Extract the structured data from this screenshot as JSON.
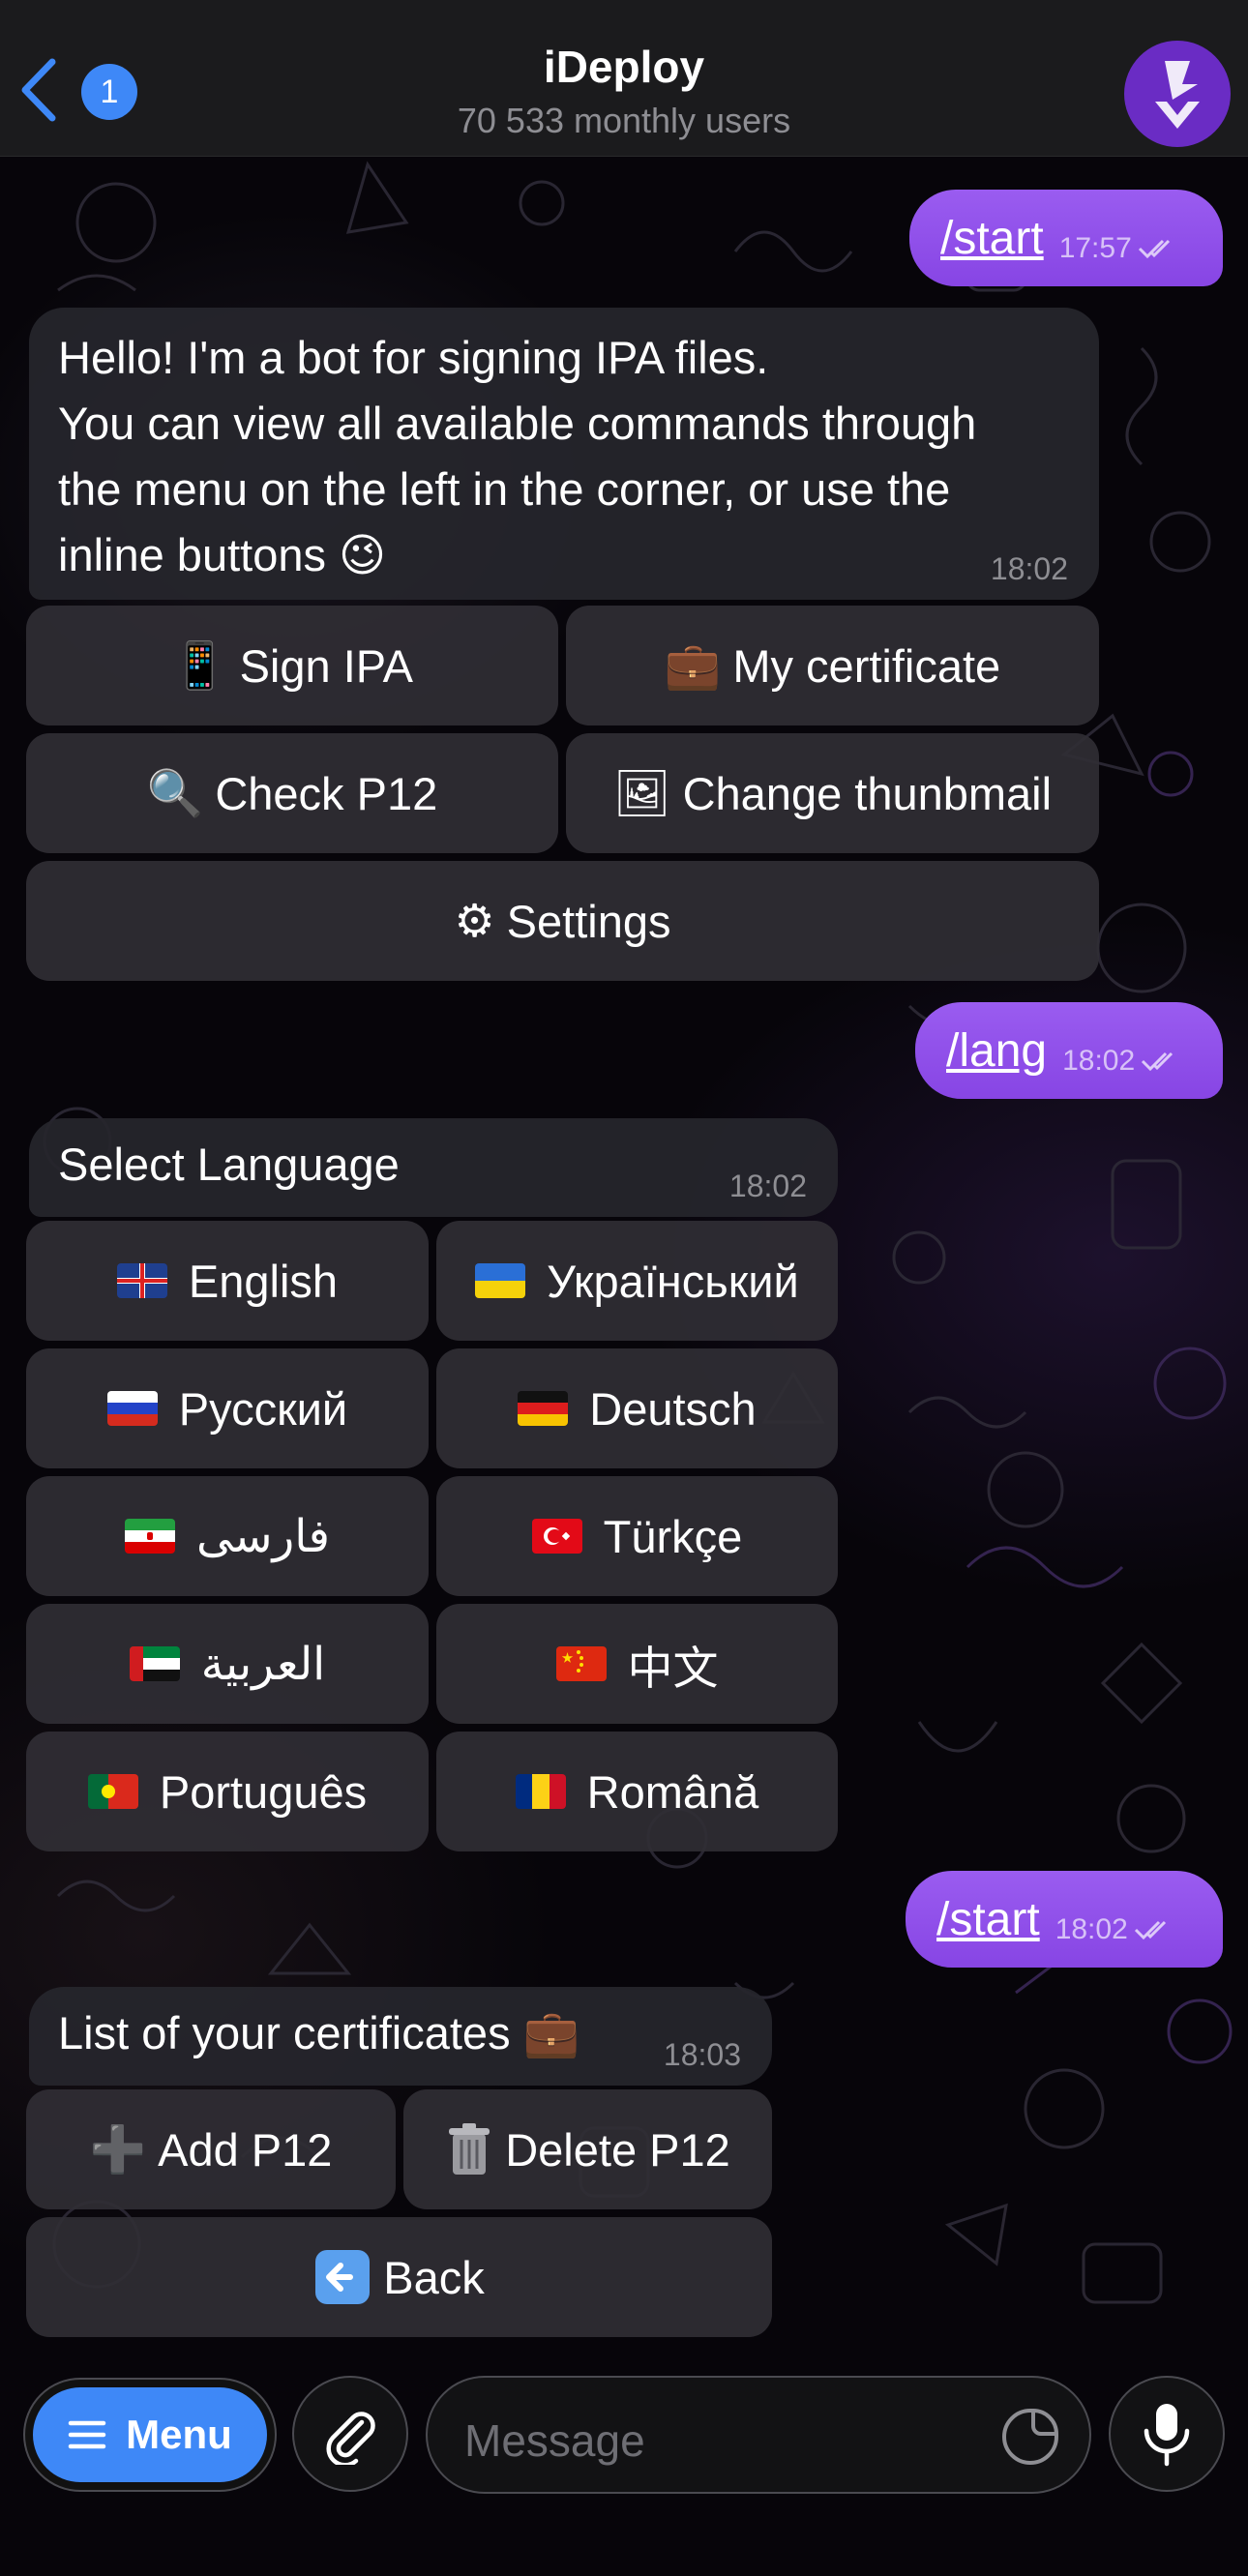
{
  "header": {
    "back_badge": "1",
    "title": "iDeploy",
    "subtitle": "70 533 monthly users"
  },
  "messages": {
    "m1": {
      "text": "/start",
      "time": "17:57"
    },
    "m2": {
      "lines": [
        "Hello! I'm a bot for signing IPA files.",
        "You can view all available commands through",
        "the menu on the left in the corner, or use the",
        "inline buttons 😉"
      ],
      "time": "18:02"
    },
    "kb1": {
      "sign_ipa": "Sign IPA",
      "my_certificate": "My certificate",
      "check_p12": "Check P12",
      "change_thumbnail": "Change thunbmail",
      "settings": "Settings"
    },
    "m3": {
      "text": "/lang",
      "time": "18:02"
    },
    "m4": {
      "text": "Select Language",
      "time": "18:02"
    },
    "languages": {
      "english": "English",
      "ukrainian": "Український",
      "russian": "Русский",
      "german": "Deutsch",
      "persian": "فارسی",
      "turkish": "Türkçe",
      "arabic": "العربية",
      "chinese": "中文",
      "portuguese": "Português",
      "romanian": "Română"
    },
    "m5": {
      "text": "/start",
      "time": "18:02"
    },
    "m6": {
      "text": "List of your certificates 💼",
      "time": "18:03"
    },
    "kb2": {
      "add_p12": "Add P12",
      "delete_p12": "Delete P12",
      "back": "Back"
    }
  },
  "input_bar": {
    "menu_label": "Menu",
    "message_placeholder": "Message"
  },
  "colors": {
    "accent_blue": "#3e88f7",
    "outgoing_bubble": "#8f50ea",
    "incoming_bubble": "#26262c",
    "keyboard_button": "#302e34"
  }
}
